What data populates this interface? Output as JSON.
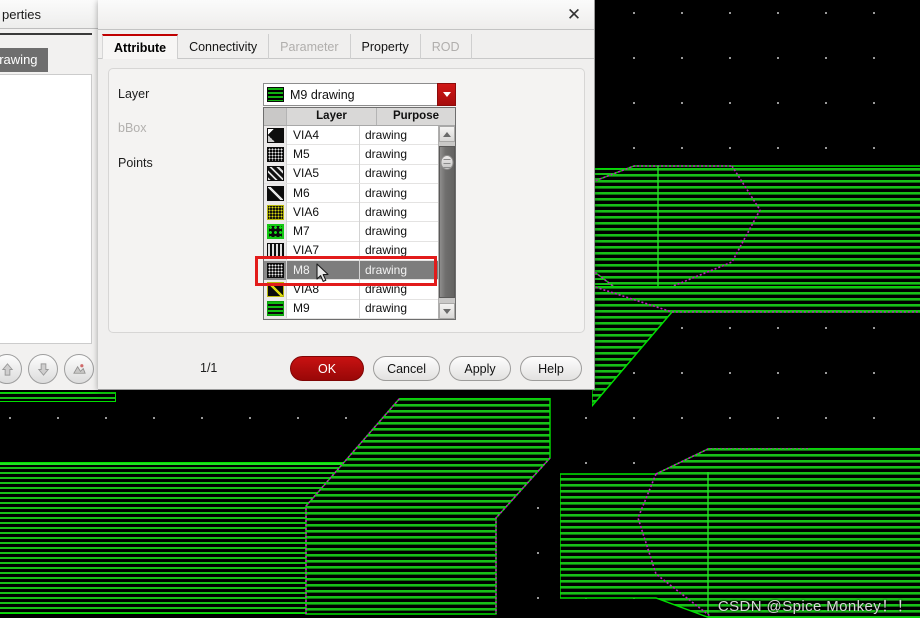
{
  "canvas": {
    "watermark": "CSDN @Spice Monkey！！",
    "background_color": "#000000",
    "metal_color": "#18c018",
    "outline_color": "#00e000",
    "dotted_edge_color": "#c020c0"
  },
  "left_panel": {
    "title": "perties",
    "selected_item": "drawing",
    "buttons": [
      {
        "name": "move-up-button",
        "icon": "arrow-up-icon"
      },
      {
        "name": "move-down-button",
        "icon": "arrow-down-icon"
      },
      {
        "name": "zoom-fit-button",
        "icon": "shape-icon"
      }
    ]
  },
  "dialog": {
    "title": "",
    "close_label": "✕",
    "tabs": [
      {
        "label": "Attribute",
        "active": true,
        "disabled": false
      },
      {
        "label": "Connectivity",
        "active": false,
        "disabled": false
      },
      {
        "label": "Parameter",
        "active": false,
        "disabled": true
      },
      {
        "label": "Property",
        "active": false,
        "disabled": false
      },
      {
        "label": "ROD",
        "active": false,
        "disabled": true
      }
    ],
    "fields": {
      "layer_label": "Layer",
      "bbox_label": "bBox",
      "points_label": "Points",
      "layer_value": "M9 drawing",
      "layer_swatch_color": "#10b010"
    },
    "dropdown": {
      "columns": [
        "Layer",
        "Purpose"
      ],
      "rows": [
        {
          "layer": "VIA4",
          "purpose": "drawing",
          "selected": false,
          "swatch": "via4"
        },
        {
          "layer": "M5",
          "purpose": "drawing",
          "selected": false,
          "swatch": "m5"
        },
        {
          "layer": "VIA5",
          "purpose": "drawing",
          "selected": false,
          "swatch": "via5"
        },
        {
          "layer": "M6",
          "purpose": "drawing",
          "selected": false,
          "swatch": "m6"
        },
        {
          "layer": "VIA6",
          "purpose": "drawing",
          "selected": false,
          "swatch": "via6"
        },
        {
          "layer": "M7",
          "purpose": "drawing",
          "selected": false,
          "swatch": "m7"
        },
        {
          "layer": "VIA7",
          "purpose": "drawing",
          "selected": false,
          "swatch": "via7"
        },
        {
          "layer": "M8",
          "purpose": "drawing",
          "selected": true,
          "swatch": "m8"
        },
        {
          "layer": "VIA8",
          "purpose": "drawing",
          "selected": false,
          "swatch": "via8"
        },
        {
          "layer": "M9",
          "purpose": "drawing",
          "selected": false,
          "swatch": "m9"
        }
      ]
    },
    "footer": {
      "page_index": "1/1",
      "ok_label": "OK",
      "cancel_label": "Cancel",
      "apply_label": "Apply",
      "help_label": "Help",
      "ok_color": "#c81212"
    },
    "annotation": {
      "color": "#e21b1b",
      "targets_row": "M8"
    }
  }
}
